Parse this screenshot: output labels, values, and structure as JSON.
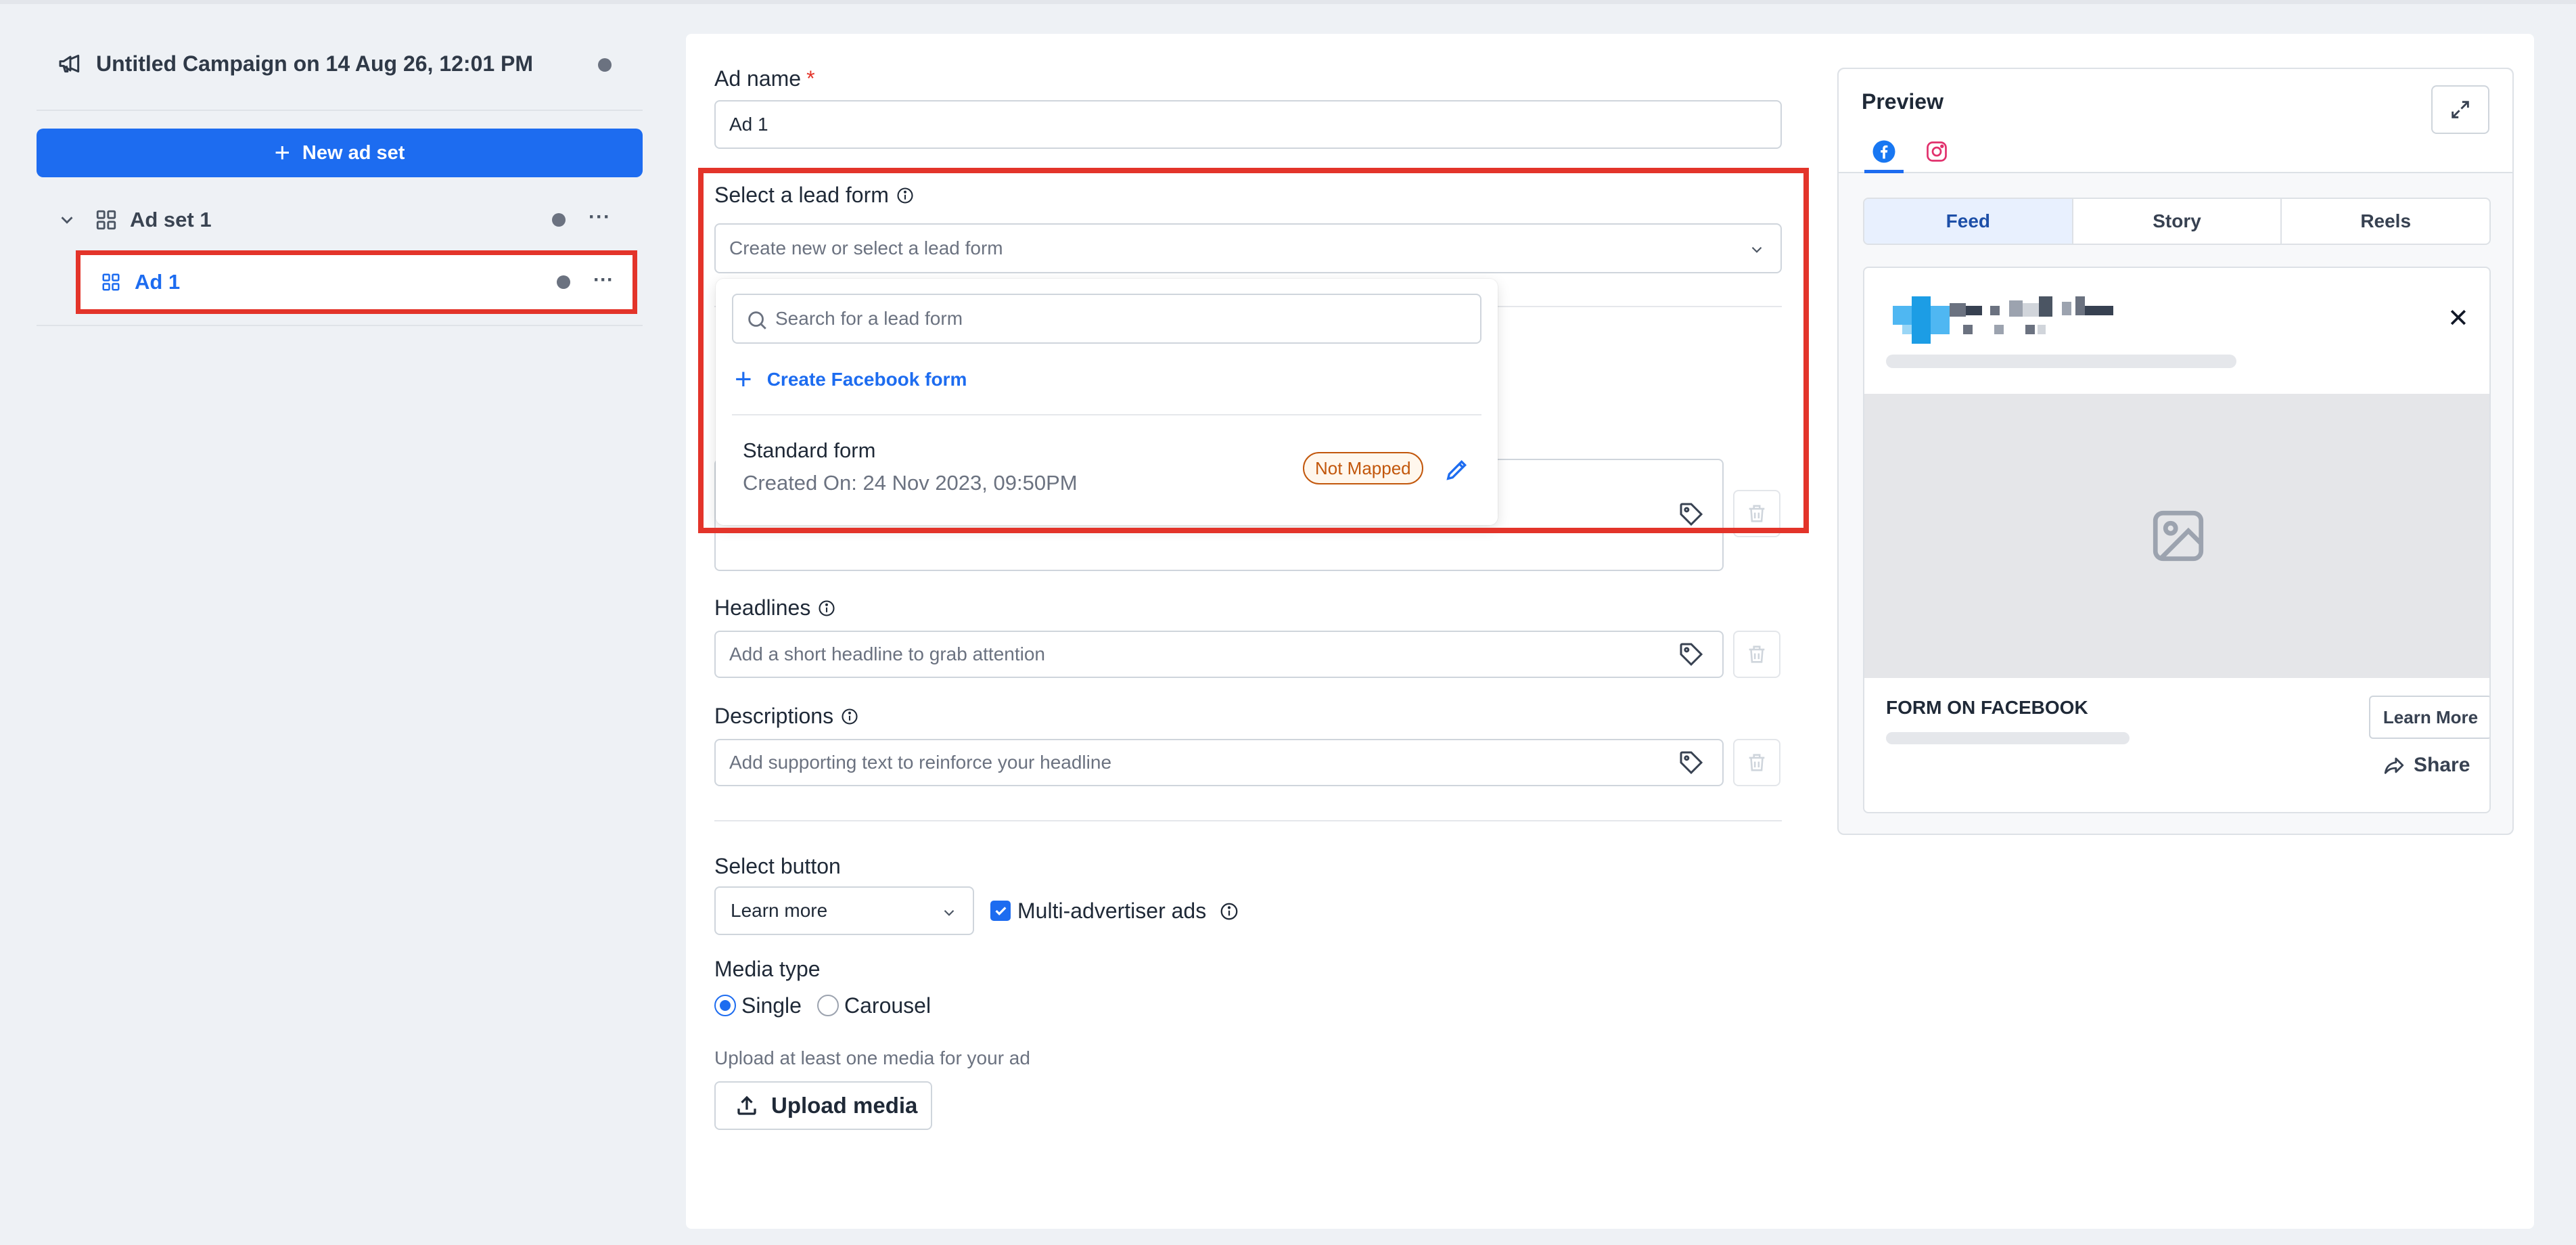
{
  "sidebar": {
    "campaign_title": "Untitled Campaign on 14 Aug 26, 12:01 PM",
    "new_adset_label": "New ad set",
    "adset_label": "Ad set 1",
    "ad_label": "Ad 1",
    "more_label": "···"
  },
  "form": {
    "ad_name_label": "Ad name",
    "required_mark": "*",
    "ad_name_value": "Ad 1",
    "lead_form_label": "Select a lead form",
    "lead_form_placeholder": "Create new or select a lead form",
    "headlines_label": "Headlines",
    "headline_placeholder": "Add a short headline to grab attention",
    "descriptions_label": "Descriptions",
    "description_placeholder": "Add supporting text to reinforce your headline",
    "select_button_label": "Select button",
    "select_button_value": "Learn more",
    "multi_advertiser_label": "Multi-advertiser ads",
    "multi_advertiser_checked": true,
    "media_type_label": "Media type",
    "media_options": [
      "Single",
      "Carousel"
    ],
    "media_selected": "Single",
    "upload_hint": "Upload at least one media for your ad",
    "upload_button": "Upload media"
  },
  "lead_dropdown": {
    "search_placeholder": "Search for a lead form",
    "create_label": "Create Facebook form",
    "forms": [
      {
        "name": "Standard form",
        "created": "Created On: 24 Nov 2023, 09:50PM",
        "status": "Not Mapped"
      }
    ]
  },
  "preview": {
    "title": "Preview",
    "tabs": [
      "facebook-icon",
      "instagram-icon"
    ],
    "placements": [
      "Feed",
      "Story",
      "Reels"
    ],
    "active_placement": "Feed",
    "cta_title": "FORM ON FACEBOOK",
    "cta_button": "Learn More",
    "share_label": "Share"
  },
  "colors": {
    "accent": "#1d6cf0",
    "highlight_border": "#e3342a",
    "badge": "#c2570c"
  }
}
